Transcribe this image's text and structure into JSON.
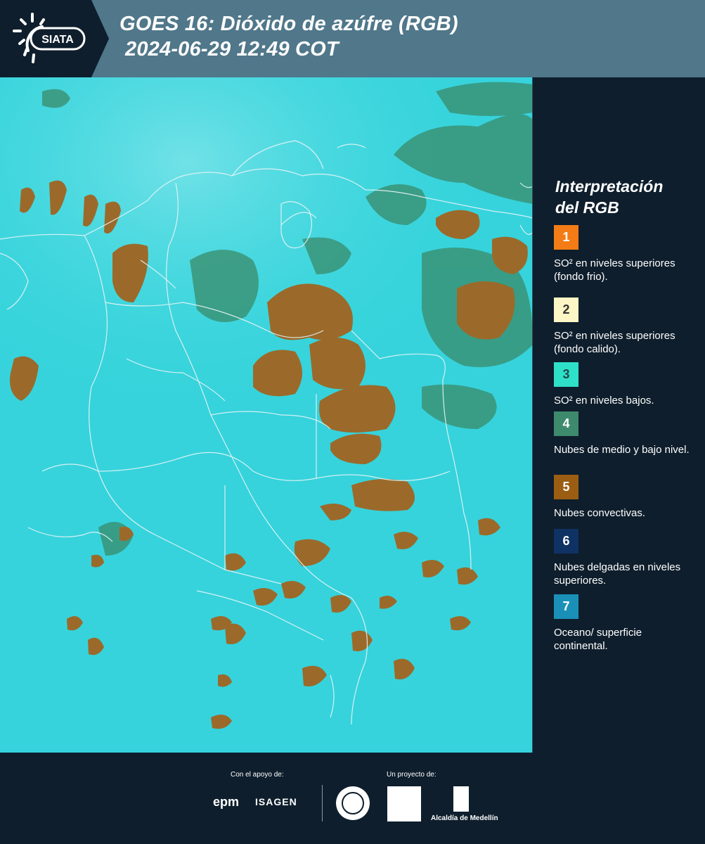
{
  "header": {
    "logo_text": "SIATA",
    "title_line1": "GOES 16: Dióxido de azúfre (RGB)",
    "title_line2": "2024-06-29 12:49 COT"
  },
  "legend": {
    "title_line1": "Interpretación",
    "title_line2": "del RGB",
    "items": [
      {
        "number": "1",
        "label": "SO² en niveles superiores (fondo frio).",
        "color": "#f47c16",
        "text_color": "#ffffff"
      },
      {
        "number": "2",
        "label": "SO² en niveles superiores (fondo calido).",
        "color": "#fdf6c5",
        "text_color": "#333333"
      },
      {
        "number": "3",
        "label": "SO² en niveles bajos.",
        "color": "#2fe0c8",
        "text_color": "#1f4a4a"
      },
      {
        "number": "4",
        "label": "Nubes de medio y bajo nivel.",
        "color": "#3e8a6c",
        "text_color": "#ffffff"
      },
      {
        "number": "5",
        "label": "Nubes convectivas.",
        "color": "#9b5d12",
        "text_color": "#ffffff"
      },
      {
        "number": "6",
        "label": "Nubes delgadas en niveles superiores.",
        "color": "#0f3264",
        "text_color": "#ffffff"
      },
      {
        "number": "7",
        "label": "Oceano/ superficie continental.",
        "color": "#1a90b8",
        "text_color": "#ffffff"
      }
    ]
  },
  "footer": {
    "support_label": "Con el apoyo de:",
    "project_label": "Un proyecto de:",
    "sponsor_1": "epm",
    "sponsor_2": "ISAGEN",
    "partner_label": "Alcaldía de Medellín"
  },
  "map_colors": {
    "background": "#38d6dc",
    "convective": "#9b6a2a",
    "mid_low": "#3a8b6a",
    "borders": "#e8f4f6"
  }
}
